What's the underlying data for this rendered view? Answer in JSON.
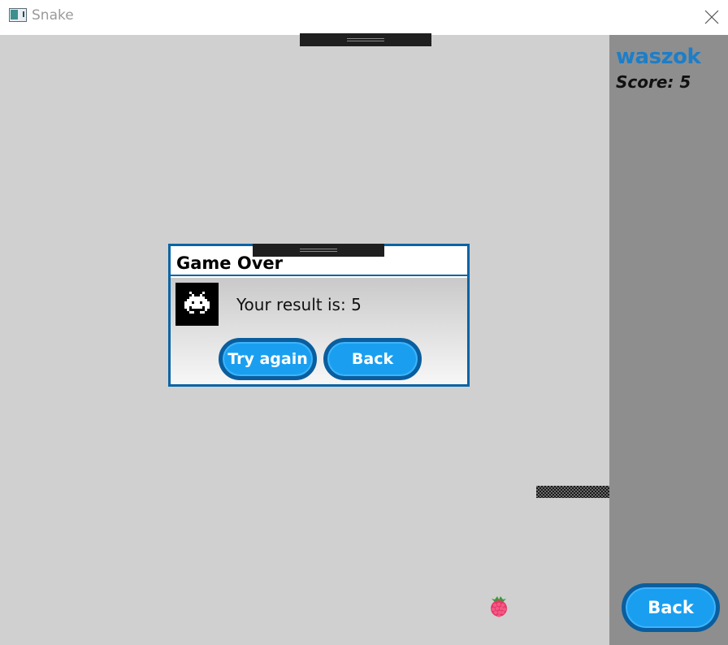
{
  "window": {
    "title": "Snake",
    "icon": "app-window-icon",
    "close_icon": "close-icon"
  },
  "sidebar": {
    "player_name": "waszok",
    "score_text": "Score: 5",
    "back_label": "Back"
  },
  "board": {
    "food_icon": "raspberry-icon",
    "snake_segment": "snake-body"
  },
  "dialog": {
    "title": "Game Over",
    "icon": "space-invader-icon",
    "result_text": "Your result is: 5",
    "try_again_label": "Try again",
    "back_label": "Back"
  },
  "colors": {
    "accent": "#1a9ff0",
    "accent_border": "#0a5e9e",
    "player_name": "#1d7ec8",
    "board": "#d0d0d0",
    "sidebar": "#8e8e8e",
    "food": "#e8386a"
  }
}
